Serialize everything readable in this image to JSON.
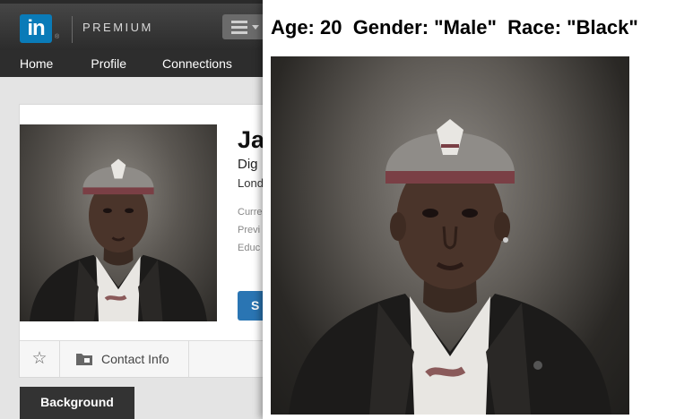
{
  "header": {
    "logo_text": "in",
    "logo_reg": "®",
    "premium_label": "PREMIUM"
  },
  "nav": {
    "items": [
      {
        "label": "Home"
      },
      {
        "label": "Profile"
      },
      {
        "label": "Connections"
      }
    ]
  },
  "profile": {
    "name_partial": "Ja",
    "headline_partial": "Dig",
    "location_partial": "Lond",
    "current_partial": "Curre",
    "previous_partial": "Previ",
    "education_partial": "Educ",
    "send_button_partial": "S",
    "contact_label": "Contact Info",
    "background_tab": "Background"
  },
  "overlay": {
    "caption": "Age: 20  Gender: \"Male\"  Race: \"Black\""
  },
  "colors": {
    "linkedin_blue": "#0a7bb8",
    "header_dark": "#2d2d2d",
    "button_blue": "#2a75b3"
  },
  "icons": {
    "logo": "linkedin-logo-icon",
    "menu": "hamburger-menu-icon",
    "star": "star-icon",
    "contact": "folder-icon"
  }
}
